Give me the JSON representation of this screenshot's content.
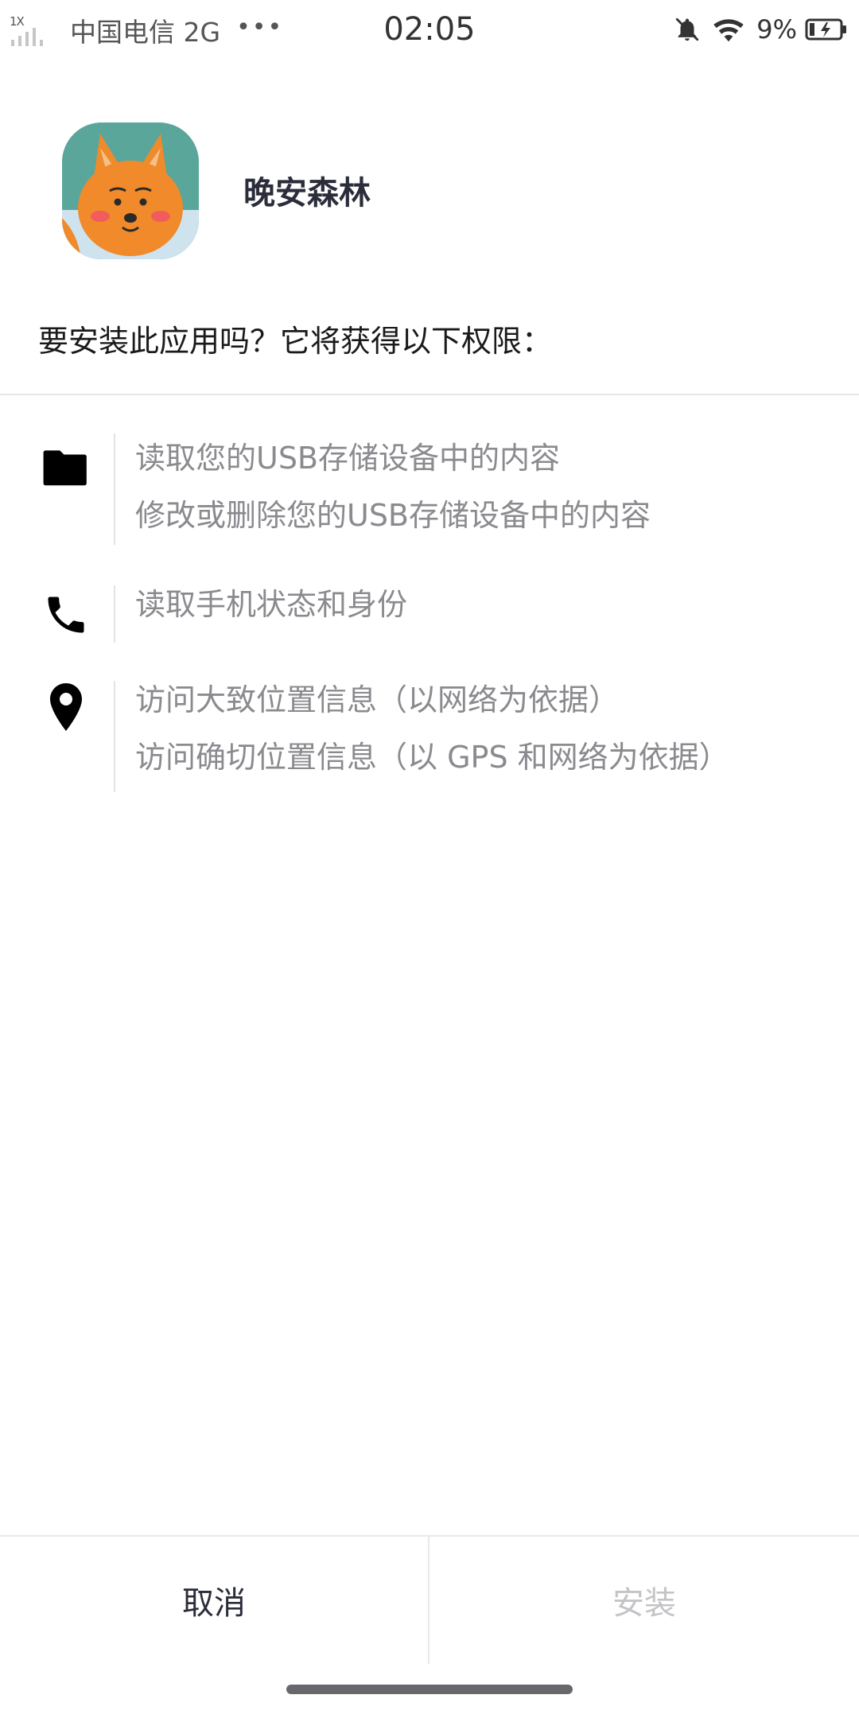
{
  "status_bar": {
    "signal_tag": "1X",
    "carrier": "中国电信 2G",
    "more_dots": "•••",
    "time": "02:05",
    "battery_percent": "9%",
    "icons": [
      "signal-icon",
      "mute-bell-icon",
      "wifi-icon",
      "battery-charging-icon"
    ]
  },
  "app": {
    "name": "晚安森林",
    "icon": "fox-app-icon"
  },
  "prompt": "要安装此应用吗？它将获得以下权限：",
  "permissions": [
    {
      "icon": "folder-icon",
      "items": [
        "读取您的USB存储设备中的内容",
        "修改或删除您的USB存储设备中的内容"
      ]
    },
    {
      "icon": "phone-icon",
      "items": [
        "读取手机状态和身份"
      ]
    },
    {
      "icon": "location-pin-icon",
      "items": [
        "访问大致位置信息（以网络为依据）",
        "访问确切位置信息（以 GPS 和网络为依据）"
      ]
    }
  ],
  "buttons": {
    "cancel": "取消",
    "install": "安装"
  },
  "colors": {
    "primary_text": "#2b2d3a",
    "secondary_text": "#8a8a8f",
    "disabled_text": "#c4c4c8",
    "icon_fox_orange": "#f08a2a",
    "icon_background_teal": "#5aa69b"
  }
}
